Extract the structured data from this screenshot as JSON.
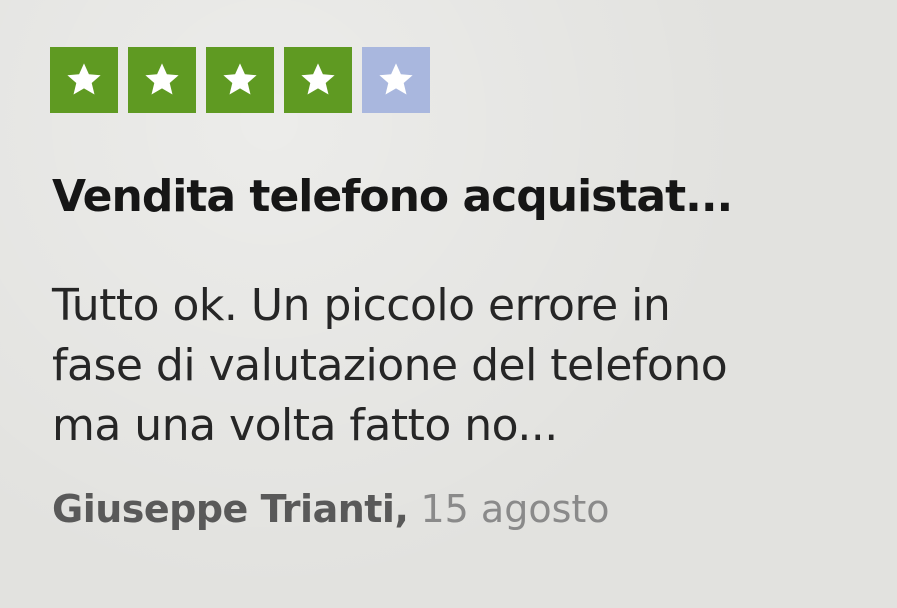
{
  "review": {
    "rating": 4,
    "max_rating": 5,
    "star_color_filled": "#5f9a22",
    "star_color_empty": "#a9b7de",
    "star_icon": "star-icon",
    "title": "Vendita telefono acquistat...",
    "body_lines": [
      "Tutto ok. Un piccolo errore in",
      "fase di valutazione del telefono",
      "ma una volta fatto no..."
    ],
    "author": "Giuseppe Trianti",
    "separator": ",",
    "date": "15 agosto"
  }
}
